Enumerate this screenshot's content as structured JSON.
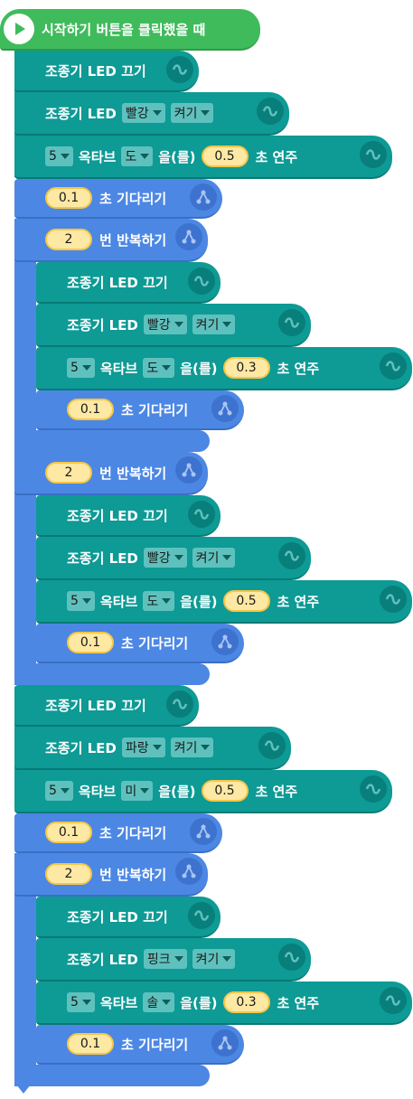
{
  "start": {
    "label": "시작하기 버튼을 클릭했을 때"
  },
  "blocks": {
    "b1": {
      "text": "조종기 LED 끄기"
    },
    "b2": {
      "text": "조종기 LED",
      "color": "빨강",
      "state": "켜기"
    },
    "b3": {
      "octave": "5",
      "octave_label": "옥타브",
      "note": "도",
      "note_suffix": "을(를)",
      "dur": "0.5",
      "tail": "초 연주"
    },
    "b4": {
      "sec": "0.1",
      "label": "초 기다리기"
    },
    "r1": {
      "count": "2",
      "label": "번 반복하기"
    },
    "r1a": {
      "text": "조종기 LED 끄기"
    },
    "r1b": {
      "text": "조종기 LED",
      "color": "빨강",
      "state": "켜기"
    },
    "r1c": {
      "octave": "5",
      "octave_label": "옥타브",
      "note": "도",
      "note_suffix": "을(를)",
      "dur": "0.3",
      "tail": "초 연주"
    },
    "r1d": {
      "sec": "0.1",
      "label": "초 기다리기"
    },
    "r2": {
      "count": "2",
      "label": "번 반복하기"
    },
    "r2a": {
      "text": "조종기 LED 끄기"
    },
    "r2b": {
      "text": "조종기 LED",
      "color": "빨강",
      "state": "켜기"
    },
    "r2c": {
      "octave": "5",
      "octave_label": "옥타브",
      "note": "도",
      "note_suffix": "을(를)",
      "dur": "0.5",
      "tail": "초 연주"
    },
    "r2d": {
      "sec": "0.1",
      "label": "초 기다리기"
    },
    "b5": {
      "text": "조종기 LED 끄기"
    },
    "b6": {
      "text": "조종기 LED",
      "color": "파랑",
      "state": "켜기"
    },
    "b7": {
      "octave": "5",
      "octave_label": "옥타브",
      "note": "미",
      "note_suffix": "을(를)",
      "dur": "0.5",
      "tail": "초 연주"
    },
    "b8": {
      "sec": "0.1",
      "label": "초 기다리기"
    },
    "r3": {
      "count": "2",
      "label": "번 반복하기"
    },
    "r3a": {
      "text": "조종기 LED 끄기"
    },
    "r3b": {
      "text": "조종기 LED",
      "color": "핑크",
      "state": "켜기"
    },
    "r3c": {
      "octave": "5",
      "octave_label": "옥타브",
      "note": "솔",
      "note_suffix": "을(를)",
      "dur": "0.3",
      "tail": "초 연주"
    },
    "r3d": {
      "sec": "0.1",
      "label": "초 기다리기"
    }
  },
  "colors": {
    "hardware": "#0e9a95",
    "flow": "#4c87e4",
    "start": "#3fbb5b",
    "number": "#fde8a4"
  },
  "icons": {
    "hardware": "link-loop-icon",
    "flow": "branch-icon",
    "start": "play-icon"
  }
}
